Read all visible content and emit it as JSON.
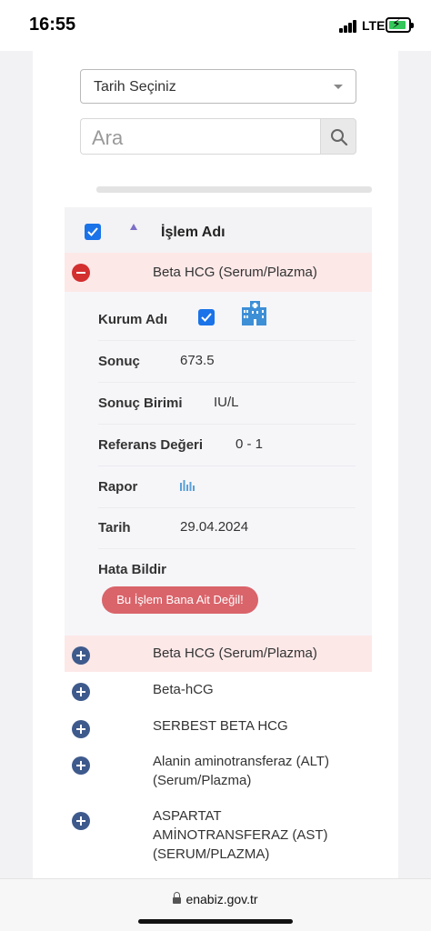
{
  "status_bar": {
    "time": "16:55",
    "network": "LTE",
    "battery_charging": true
  },
  "filters": {
    "date_select": {
      "selected": "Tarih Seçiniz"
    },
    "search": {
      "placeholder": "Ara",
      "icon": "search-icon"
    }
  },
  "table": {
    "header": {
      "column_label": "İşlem Adı",
      "select_all_checked": true,
      "sort": "ascending"
    },
    "expanded_row": {
      "name": "Beta HCG (Serum/Plazma)",
      "details": {
        "kurum_adi_label": "Kurum Adı",
        "kurum_icon": "hospital-icon",
        "sonuc_label": "Sonuç",
        "sonuc_value": "673.5",
        "sonuc_birimi_label": "Sonuç Birimi",
        "sonuc_birimi_value": "IU/L",
        "referans_label": "Referans Değeri",
        "referans_value": "0 - 1",
        "rapor_label": "Rapor",
        "rapor_icon": "bar-chart-icon",
        "tarih_label": "Tarih",
        "tarih_value": "29.04.2024",
        "hata_label": "Hata Bildir",
        "hata_button": "Bu İşlem Bana Ait Değil!"
      }
    },
    "rows": [
      {
        "name": "Beta HCG (Serum/Plazma)"
      },
      {
        "name": "Beta-hCG"
      },
      {
        "name": "SERBEST BETA HCG"
      },
      {
        "name_line1": "Alanin aminotransferaz (ALT)",
        "name_line2": "(Serum/Plazma)"
      },
      {
        "name_line1": "ASPARTAT",
        "name_line2": "AMİNOTRANSFERAZ (AST)",
        "name_line3": "(SERUM/PLAZMA)"
      }
    ]
  },
  "browser": {
    "url": "enabiz.gov.tr"
  },
  "colors": {
    "highlight_row": "#fde8e8",
    "checkbox": "#1a73e8",
    "collapse_toggle": "#d32f2f",
    "expand_toggle": "#3e5a8c",
    "report_button": "#d9646a"
  }
}
